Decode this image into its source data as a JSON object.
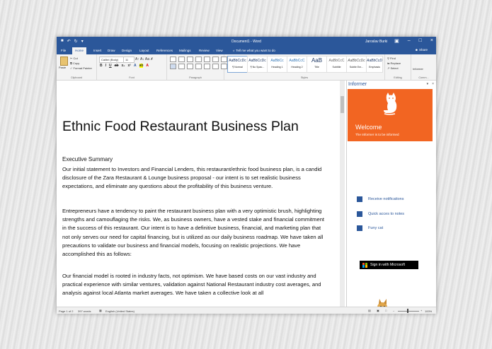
{
  "window": {
    "doc_title": "Document1 - Word",
    "user": "Jaroslav Burki",
    "qat_icons": [
      "save-icon",
      "undo-icon",
      "redo-icon"
    ]
  },
  "tabs": [
    {
      "label": "File"
    },
    {
      "label": "Home",
      "active": true
    },
    {
      "label": "Insert"
    },
    {
      "label": "Draw"
    },
    {
      "label": "Design"
    },
    {
      "label": "Layout"
    },
    {
      "label": "References"
    },
    {
      "label": "Mailings"
    },
    {
      "label": "Review"
    },
    {
      "label": "View"
    }
  ],
  "tell_me": "Tell me what you want to do",
  "share": "Share",
  "ribbon": {
    "clipboard": {
      "paste": "Paste",
      "cut": "Cut",
      "copy": "Copy",
      "format_painter": "Format Painter",
      "label": "Clipboard"
    },
    "font": {
      "name": "Calibri (Body)",
      "size": "11",
      "label": "Font"
    },
    "paragraph": {
      "label": "Paragraph"
    },
    "styles": {
      "label": "Styles",
      "items": [
        {
          "sample": "AaBbCcDc",
          "name": "¶ Normal"
        },
        {
          "sample": "AaBbCcDc",
          "name": "¶ No Spac..."
        },
        {
          "sample": "AaBbCc",
          "name": "Heading 1"
        },
        {
          "sample": "AaBbCcC",
          "name": "Heading 2"
        },
        {
          "sample": "AaB",
          "name": "Title"
        },
        {
          "sample": "AaBbCcC",
          "name": "Subtitle"
        },
        {
          "sample": "AaBbCcDc",
          "name": "Subtle Em..."
        },
        {
          "sample": "AaBbCcDc",
          "name": "Emphasis"
        }
      ]
    },
    "editing": {
      "find": "Find",
      "replace": "Replace",
      "select": "Select",
      "label": "Editing"
    },
    "comments": {
      "label": "Comm..."
    },
    "informer": {
      "label": "Informer"
    }
  },
  "document": {
    "title": "Ethnic Food Restaurant Business Plan",
    "section": "Executive Summary",
    "paragraphs": [
      "Our initial statement to Investors and Financial Lenders, this restaurant/ethnic food business plan, is a candid disclosure of the Zara Restaurant & Lounge business proposal - our intent is to set realistic business expectations, and eliminate any questions about the profitability of this business venture.",
      "Entrepreneurs have a tendency to paint the restaurant business plan with a very optimistic brush, highlighting strengths and camouflaging the risks. We, as business owners, have a vested stake and financial commitment in the success of this restaurant. Our intent is to have a definitive business, financial, and marketing plan that not only serves our need for capital financing, but is utilized as our daily business roadmap. We have taken all precautions to validate our business and financial models, focusing on realistic projections. We have accomplished this as follows:",
      "Our financial model is rooted in industry facts, not optimism. We have based costs on our vast industry and practical experience with similar ventures, validation against National Restaurant industry cost averages, and analysis against local Atlanta market averages. We have taken a collective look at all"
    ]
  },
  "informer": {
    "pane_title": "Informer",
    "welcome": "Welcome",
    "tagline": "The Informer is to be informed",
    "features": [
      {
        "label": "Receive notifications",
        "icon": "notification-icon"
      },
      {
        "label": "Quick acces to notes",
        "icon": "notes-icon"
      },
      {
        "label": "Funy cat",
        "icon": "cat-icon"
      }
    ],
    "sign_in": "Sign in with Microsoft",
    "brand_orange": "#f26522",
    "word_blue": "#2b579a"
  },
  "status": {
    "page": "Page 1 of 2",
    "words": "397 words",
    "language": "English (United States)",
    "zoom": "100%"
  }
}
